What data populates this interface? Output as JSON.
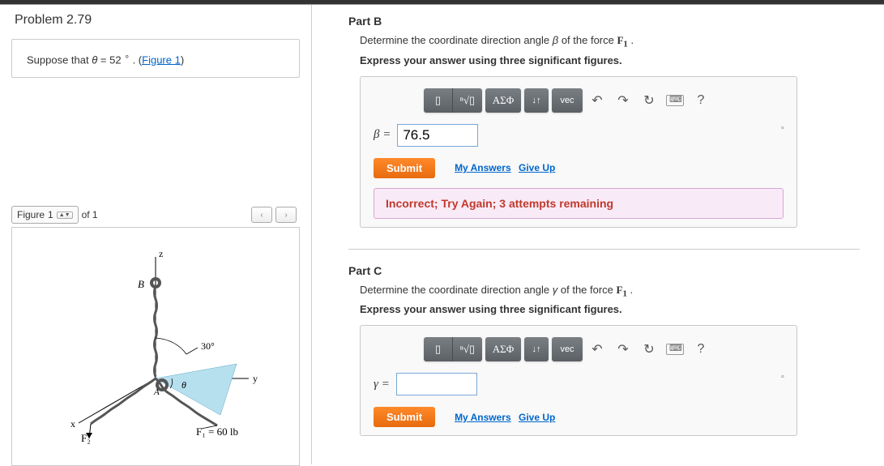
{
  "problem_title": "Problem 2.79",
  "suppose_prefix": "Suppose that ",
  "suppose_theta": "θ",
  "suppose_eq": " = 52 ",
  "suppose_deg": "∘",
  "suppose_dot": " . (",
  "figure_link": "Figure 1",
  "close_paren": ")",
  "figure_tab_label": "Figure",
  "figure_tab_num": "1",
  "figure_of": "of 1",
  "figure": {
    "z": "z",
    "y": "y",
    "x": "x",
    "B": "B",
    "A": "A",
    "angle30": "30°",
    "theta": "θ",
    "F1_label": "F₁ = 60 lb",
    "F2_label": "F₂"
  },
  "partB": {
    "title": "Part B",
    "prompt_pre": "Determine the coordinate direction angle ",
    "prompt_var": "β",
    "prompt_post": " of the force ",
    "prompt_force": "F",
    "prompt_sub": "1",
    "prompt_end": " .",
    "instruct": "Express your answer using three significant figures.",
    "var": "β =",
    "value": "76.5",
    "submit": "Submit",
    "my_answers": "My Answers",
    "give_up": "Give Up",
    "feedback": "Incorrect; Try Again; 3 attempts remaining"
  },
  "partC": {
    "title": "Part C",
    "prompt_pre": "Determine the coordinate direction angle ",
    "prompt_var": "γ",
    "prompt_post": " of the force ",
    "prompt_force": "F",
    "prompt_sub": "1",
    "prompt_end": " .",
    "instruct": "Express your answer using three significant figures.",
    "var": "γ =",
    "value": "",
    "submit": "Submit",
    "my_answers": "My Answers",
    "give_up": "Give Up"
  },
  "toolbar": {
    "templates": "▯",
    "radical": "ⁿ√▯",
    "greek": "ΑΣΦ",
    "subscript": "↓↑",
    "vec": "vec",
    "undo": "↶",
    "redo": "↷",
    "reset": "↻",
    "help": "?",
    "degree": "∘"
  }
}
